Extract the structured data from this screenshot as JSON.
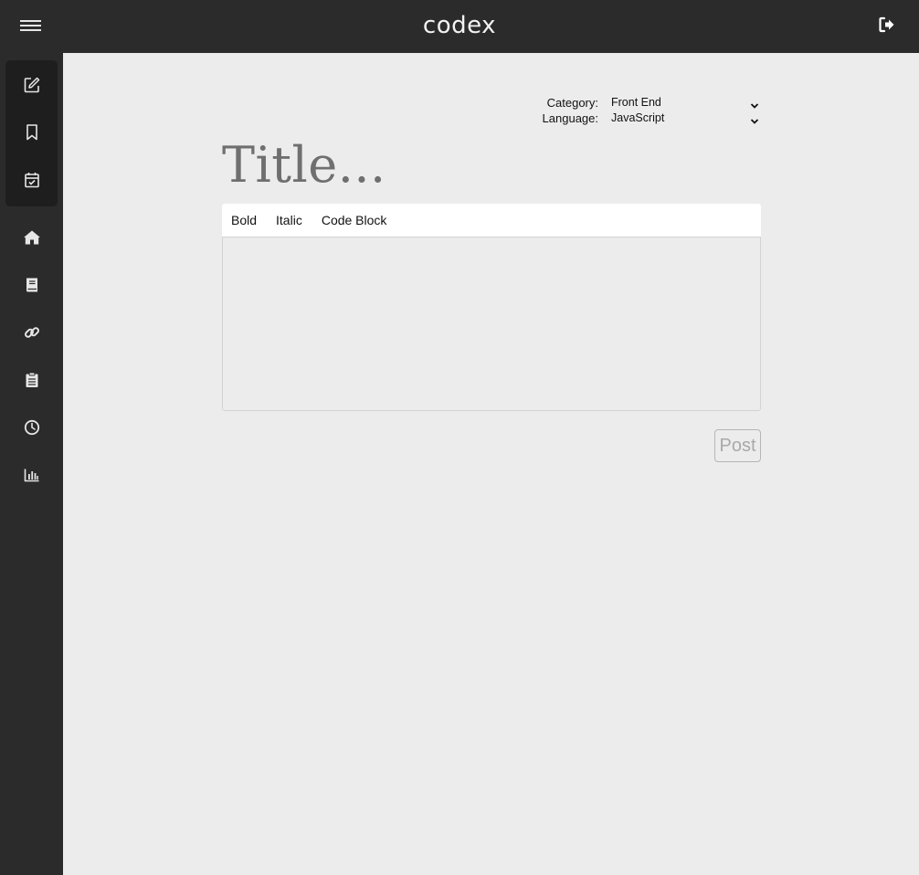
{
  "header": {
    "brand": "codex",
    "menu_icon": "hamburger-icon",
    "logout_icon": "sign-out-icon"
  },
  "sidebar": {
    "group_items": [
      {
        "icon": "edit-icon",
        "label": ""
      },
      {
        "icon": "bookmark-icon",
        "label": ""
      },
      {
        "icon": "calendar-check-icon",
        "label": ""
      }
    ],
    "items": [
      {
        "icon": "home-icon"
      },
      {
        "icon": "book-icon"
      },
      {
        "icon": "link-icon"
      },
      {
        "icon": "clipboard-icon"
      },
      {
        "icon": "clock-icon"
      },
      {
        "icon": "bar-chart-icon"
      }
    ]
  },
  "editor": {
    "category_label": "Category:",
    "category_value": "Front End",
    "language_label": "Language:",
    "language_value": "JavaScript",
    "title_placeholder": "Title...",
    "toolbar": {
      "bold": "Bold",
      "italic": "Italic",
      "code_block": "Code Block"
    },
    "body_value": "",
    "post_label": "Post"
  },
  "colors": {
    "chrome_bg": "#2b2b2b",
    "sidebar_group_bg": "#1e1e1e",
    "page_bg": "#ececec",
    "icon_color": "#e6e6e6",
    "title_placeholder_color": "#6f6f6f",
    "post_disabled_text": "#a9a9a9"
  }
}
